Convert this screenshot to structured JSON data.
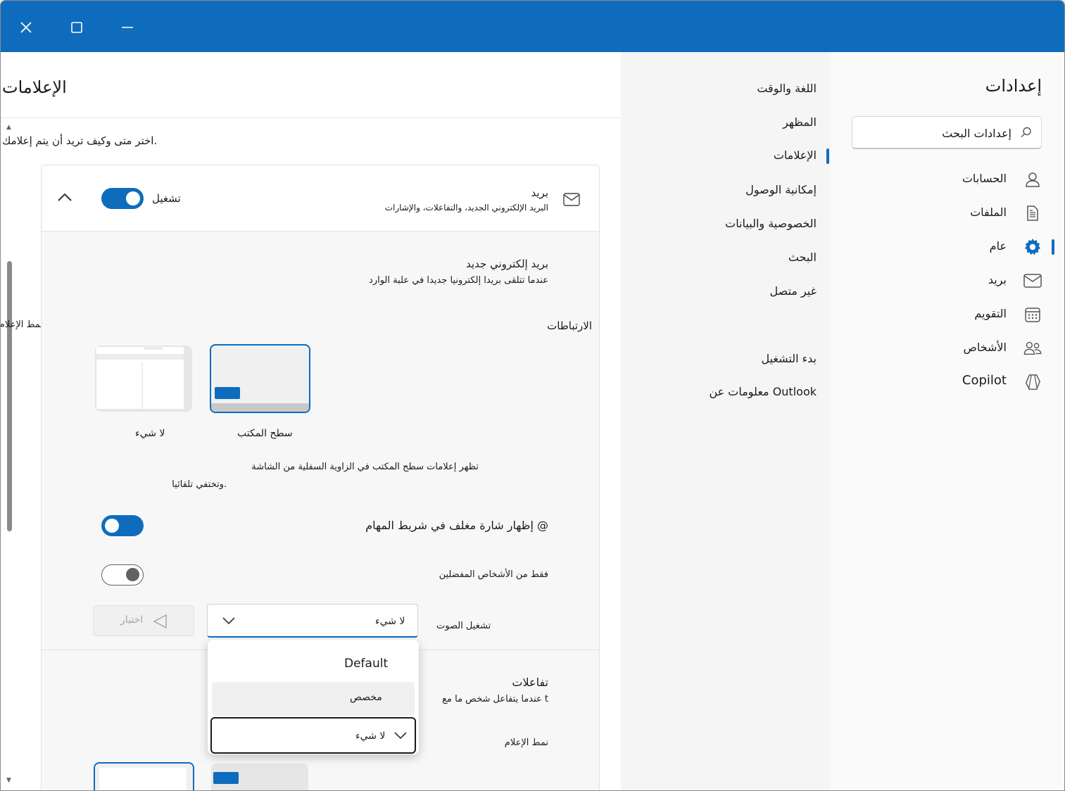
{
  "window": {
    "close_icon": "close-icon",
    "maximize_icon": "maximize-icon",
    "minimize_icon": "minimize-icon"
  },
  "nav": {
    "title": "إعدادات",
    "search_placeholder": "إعدادات البحث",
    "items": [
      {
        "label": "الحسابات",
        "icon": "person-icon"
      },
      {
        "label": "الملفات",
        "icon": "document-icon"
      },
      {
        "label": "عام",
        "icon": "gear-icon",
        "selected": true
      },
      {
        "label": "بريد",
        "icon": "mail-icon"
      },
      {
        "label": "التقويم",
        "icon": "calendar-icon"
      },
      {
        "label": "الأشخاص",
        "icon": "people-icon"
      },
      {
        "label": "Copilot",
        "icon": "copilot-icon"
      }
    ]
  },
  "subnav": {
    "items": [
      {
        "label": "اللغة والوقت"
      },
      {
        "label": "المظهر"
      },
      {
        "label": "الإعلامات",
        "selected": true
      },
      {
        "label": "إمكانية الوصول"
      },
      {
        "label": "الخصوصية والبيانات"
      },
      {
        "label": "البحث"
      },
      {
        "label": "غير متصل"
      },
      {
        "label": "بدء التشغيل"
      },
      {
        "label": "معلومات عن Outlook"
      }
    ]
  },
  "content": {
    "title": "الإعلامات",
    "description": "اختر متى وكيف تريد أن يتم إعلامك.",
    "side_cut_label": "نمط الإعلام",
    "mail_card": {
      "title": "بريد",
      "subtitle": "البريد الإلكتروني الجديد، والتفاعلات، والإشارات",
      "toggle_label": "تشغيل",
      "toggle_on": true,
      "new_mail_title": "بريد إلكتروني جديد",
      "new_mail_desc": "عندما تتلقى بريدا إلكترونيا جديدا في علبة الوارد",
      "links_label": "الارتباطات",
      "style_desktop": "سطح المكتب",
      "style_none": "لا شيء",
      "selected_style": "سطح المكتب",
      "desktop_desc_1": "تظهر إعلامات سطح المكتب في الزاوية السفلية من الشاشة",
      "desktop_desc_2": "وتختفي تلقائيا.",
      "badge_label": "إظهار شارة مغلف في شريط المهام @",
      "badge_on": true,
      "favorites_label": "فقط من الأشخاص المفضلين",
      "favorites_on": false,
      "sound_label": "تشغيل الصوت",
      "sound_value": "لا شيء",
      "choose_button": "اختيار",
      "reactions_title": "تفاعلات",
      "reactions_desc": "عندما يتفاعل شخص ما مع t",
      "reactions_style_label": "نمط الإعلام"
    },
    "sound_dropdown": {
      "options": [
        "Default",
        "مخصص"
      ],
      "hovered": "مخصص",
      "bottom_value": "لا شيء"
    }
  },
  "colors": {
    "accent": "#0f6cbd",
    "titlebar": "#0f6cbd"
  }
}
